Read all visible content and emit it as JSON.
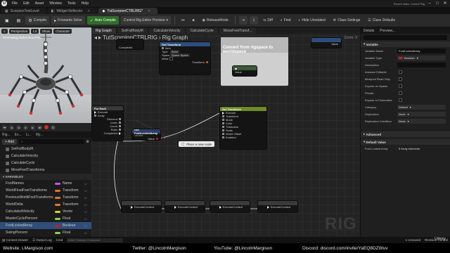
{
  "menubar": {
    "items": [
      "File",
      "Edit",
      "Asset",
      "Window",
      "Tools",
      "Help"
    ],
    "classes_label": "Parent class: Control Rig"
  },
  "tabs": [
    {
      "label": "ScorpionTestLevel"
    },
    {
      "label": "Widget Reflector"
    },
    {
      "label": "TutScorpionCTRLRIG*"
    }
  ],
  "toolbar": {
    "compile": "Compile",
    "forwards_solve": "Forwards Solve",
    "auto_compile": "Auto Compile",
    "editor_preview": "Control Rig Editor Preview",
    "release_mode": "ReleaseMode",
    "diff": "Diff",
    "find": "Find",
    "hide_unrelated": "Hide Unrelated",
    "class_settings": "Class Settings",
    "class_defaults": "Class Defaults"
  },
  "viewport": {
    "perspective": "Perspective",
    "lit": "Lit",
    "show": "Show",
    "character": "Character",
    "preview_text": "Previewing Reference Pose"
  },
  "left_panel": {
    "tabs": [
      "Rig...",
      "Ex...",
      "Li...",
      "My..."
    ],
    "add_label": "+ Add",
    "functions": [
      "SetFullBodyIK",
      "CalculateVelocity",
      "CalculateCycle",
      "MoveFeetTransforms"
    ],
    "variables_header": "VARIABLES",
    "variables": [
      {
        "name": "FootNames",
        "type": "Name",
        "color": "#c15ad8"
      },
      {
        "name": "WorldFinalFootTransforms",
        "type": "Transform",
        "color": "#e0743a"
      },
      {
        "name": "PreviousWorldFootTransforms",
        "type": "Transform",
        "color": "#e0743a"
      },
      {
        "name": "WorldDelta",
        "type": "Transform",
        "color": "#e0743a"
      },
      {
        "name": "CalculatedVelocity",
        "type": "Vector",
        "color": "#e8c541"
      },
      {
        "name": "MasterCyclePercent",
        "type": "Float",
        "color": "#8ad04a"
      },
      {
        "name": "FootLockedArray",
        "type": "Boolean",
        "color": "#c02020"
      },
      {
        "name": "SwingPercent",
        "type": "Float",
        "color": "#8ad04a"
      }
    ]
  },
  "graph": {
    "tabs": [
      "Rig Graph",
      "SetFullBodyIK",
      "CalculateVelocity",
      "CalculateCycle",
      "MoveFeetTransf..."
    ],
    "breadcrumb": [
      "TutScorpionCTRLRIG",
      "Rig Graph"
    ],
    "zoom": "Zoom -3",
    "comment_text": "Convert from rigspace to worldspace",
    "for_each_title": "For Each",
    "for_each_pins": [
      "Execute",
      "Array",
      "Element",
      "Index",
      "Count",
      "Ratio",
      "Completed"
    ],
    "get_node_title": "Get FootLockedArray",
    "get_node_sub": "Variable",
    "get_node_pin": "Value",
    "new_node_label": "Place a new node",
    "set_transform_title": "Set Transform",
    "set_transform_pins": [
      "Execute",
      "Transform",
      "Mode",
      "Color",
      "Thickness",
      "Scale",
      "World Offset",
      "Enabled"
    ],
    "bottom_nodes": [
      "ExecuteContext",
      "ExecuteContext",
      "ExecuteContext",
      "ExecuteContext"
    ],
    "watermark": "RIG",
    "get_transform_label": "Get Transform",
    "get_transform_rows": [
      "Item",
      "Type",
      "Space",
      "Initial"
    ],
    "get_transform_vals": [
      "",
      "Bone",
      "Space Space",
      ""
    ],
    "get_transform_pin": "Transform",
    "top_value_label": "Value",
    "top_left_label": "Completed"
  },
  "details": {
    "tabs": [
      "Details",
      "Preview..."
    ],
    "section_variable": "Variable",
    "rows": [
      {
        "label": "Variable Name",
        "value": "FootLockedArray"
      },
      {
        "label": "Variable Type",
        "value": "Boolean"
      },
      {
        "label": "Description",
        "value": ""
      },
      {
        "label": "Instance Editable",
        "value": ""
      },
      {
        "label": "Blueprint Read Only",
        "value": ""
      },
      {
        "label": "Expose on Spawn",
        "value": ""
      },
      {
        "label": "Private",
        "value": ""
      },
      {
        "label": "Expose to Cinematics",
        "value": ""
      },
      {
        "label": "Category",
        "value": "Default"
      },
      {
        "label": "Replication",
        "value": "None"
      },
      {
        "label": "Replication Condition",
        "value": "None"
      }
    ],
    "section_advanced": "Advanced",
    "section_default": "Default Value",
    "default_label": "Foot Locked Array",
    "default_value": "5 Array elements"
  },
  "bottombar": {
    "content_drawer": "Content Drawer",
    "output_log": "Output Log",
    "cmd": "Cmd",
    "console_placeholder": "Enter Console Command",
    "unsaved": "1 Unsaved",
    "revision": "Revision Control"
  },
  "footer": {
    "website": "Website: LMargison.com",
    "twitter": "Twitter: @LincolnMargison",
    "youtube": "YouTube: @LincolnMargison",
    "discord": "Discord: discord.com/invite/YaEQ8DZWuv",
    "udemy": "Udemy"
  }
}
